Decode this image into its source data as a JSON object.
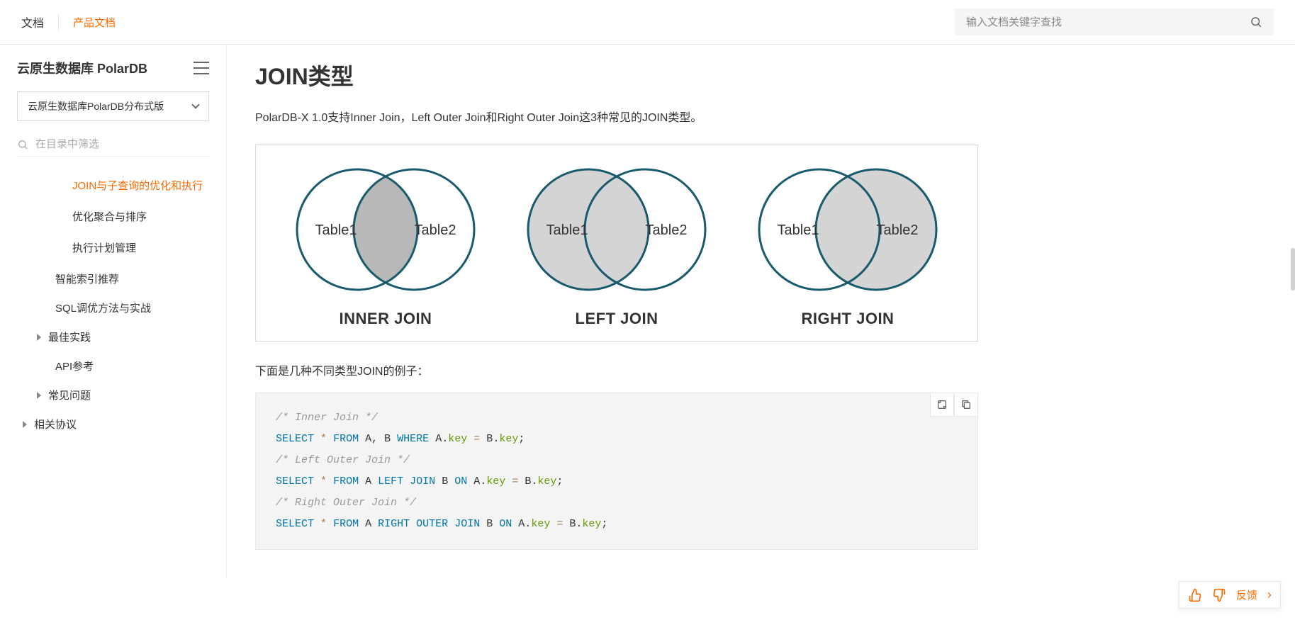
{
  "top": {
    "doc": "文档",
    "product_doc": "产品文档",
    "search_placeholder": "输入文档关键字查找"
  },
  "sidebar": {
    "title": "云原生数据库 PolarDB",
    "version": "云原生数据库PolarDB分布式版",
    "filter_placeholder": "在目录中筛选",
    "items": {
      "join_subquery": "JOIN与子查询的优化和执行",
      "agg_sort": "优化聚合与排序",
      "plan_mgmt": "执行计划管理",
      "smart_index": "智能索引推荐",
      "sql_tune": "SQL调优方法与实战",
      "best_practice": "最佳实践",
      "api_ref": "API参考",
      "faq": "常见问题",
      "agreement": "相关协议"
    }
  },
  "content": {
    "title": "JOIN类型",
    "intro": "PolarDB-X 1.0支持Inner Join，Left Outer Join和Right Outer Join这3种常见的JOIN类型。",
    "venn": {
      "table1": "Table1",
      "table2": "Table2",
      "inner": "INNER JOIN",
      "left": "LEFT JOIN",
      "right": "RIGHT JOIN"
    },
    "subtext": "下面是几种不同类型JOIN的例子：",
    "code": {
      "c1": "/* Inner Join */",
      "c2": "/* Left Outer Join */",
      "c3": "/* Right Outer Join */"
    }
  },
  "feedback": {
    "label": "反馈"
  }
}
